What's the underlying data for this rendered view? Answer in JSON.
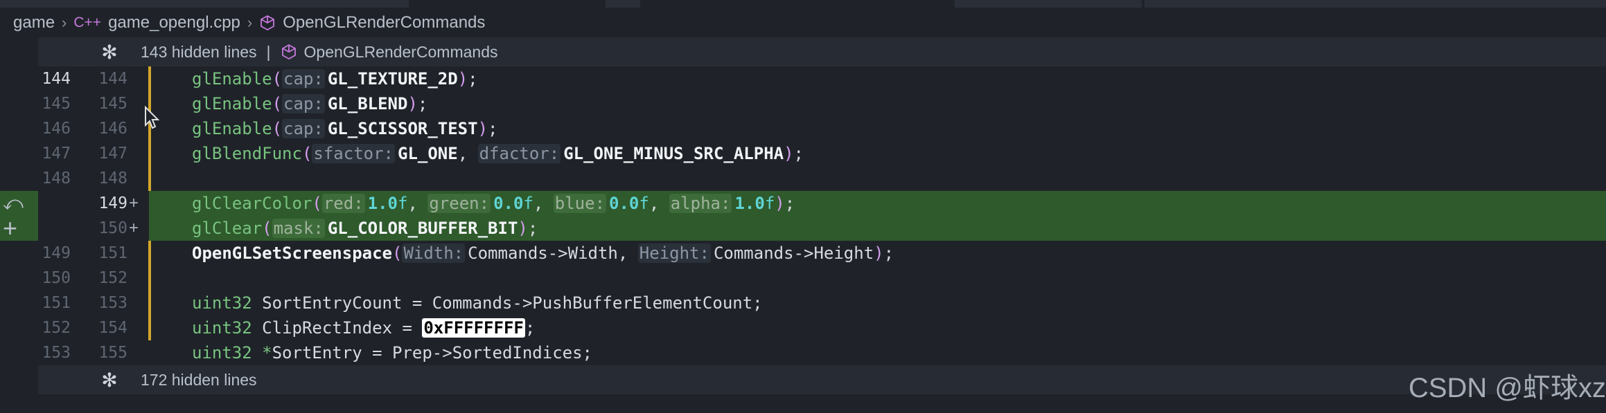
{
  "breadcrumb": {
    "items": [
      "game",
      "game_opengl.cpp",
      "OpenGLRenderCommands"
    ],
    "cpp_glyph": "C++"
  },
  "hidden_top": {
    "label": "143 hidden lines",
    "separator": "|",
    "symbol": "OpenGLRenderCommands"
  },
  "hidden_bottom": {
    "label": "172 hidden lines"
  },
  "code": {
    "r1": {
      "old": "144",
      "new": "144"
    },
    "r2": {
      "old": "145",
      "new": "145"
    },
    "r3": {
      "old": "146",
      "new": "146"
    },
    "r4": {
      "old": "147",
      "new": "147"
    },
    "r5": {
      "old": "148",
      "new": "148"
    },
    "r6": {
      "old": "",
      "new": "149",
      "added": "+"
    },
    "r7": {
      "old": "",
      "new": "150",
      "added": "+"
    },
    "r8": {
      "old": "149",
      "new": "151"
    },
    "r9": {
      "old": "150",
      "new": "152"
    },
    "r10": {
      "old": "151",
      "new": "153"
    },
    "r11": {
      "old": "152",
      "new": "154"
    },
    "r12": {
      "old": "153",
      "new": "155"
    },
    "t": {
      "glEnable": "glEnable",
      "glBlendFunc": "glBlendFunc",
      "glClearColor": "glClearColor",
      "glClear": "glClear",
      "OpenGLSetScreenspace": "OpenGLSetScreenspace",
      "cap": "cap:",
      "sfactor": "sfactor:",
      "dfactor": "dfactor:",
      "red": "red:",
      "green": "green:",
      "blue": "blue:",
      "alpha": "alpha:",
      "mask": "mask:",
      "Width": "Width:",
      "Height": "Height:",
      "GL_TEXTURE_2D": "GL_TEXTURE_2D",
      "GL_BLEND": "GL_BLEND",
      "GL_SCISSOR_TEST": "GL_SCISSOR_TEST",
      "GL_ONE": "GL_ONE",
      "GL_ONE_MINUS_SRC_ALPHA": "GL_ONE_MINUS_SRC_ALPHA",
      "GL_COLOR_BUFFER_BIT": "GL_COLOR_BUFFER_BIT",
      "one": "1.0",
      "zero": "0.0",
      "f": "f",
      "CmdWidth": "Commands->Width",
      "CmdHeight": "Commands->Height",
      "uint32": "uint32",
      "SortEntryCount": " SortEntryCount = Commands->PushBufferElementCount;",
      "ClipRectIndex": " ClipRectIndex = ",
      "hex": "0xFFFFFFFF",
      "SortEntryPre": " ",
      "star": "*",
      "SortEntryRest": "SortEntry = Prep->SortedIndices;"
    }
  },
  "gutter_icons": {
    "revert": "revert-icon",
    "add": "add-icon"
  },
  "watermark": "CSDN @虾球xz",
  "colors": {
    "added_bg": "#2f5a2c",
    "changed_marker": "#d4a72c",
    "function": "#78c380",
    "number": "#5fd4d4"
  }
}
